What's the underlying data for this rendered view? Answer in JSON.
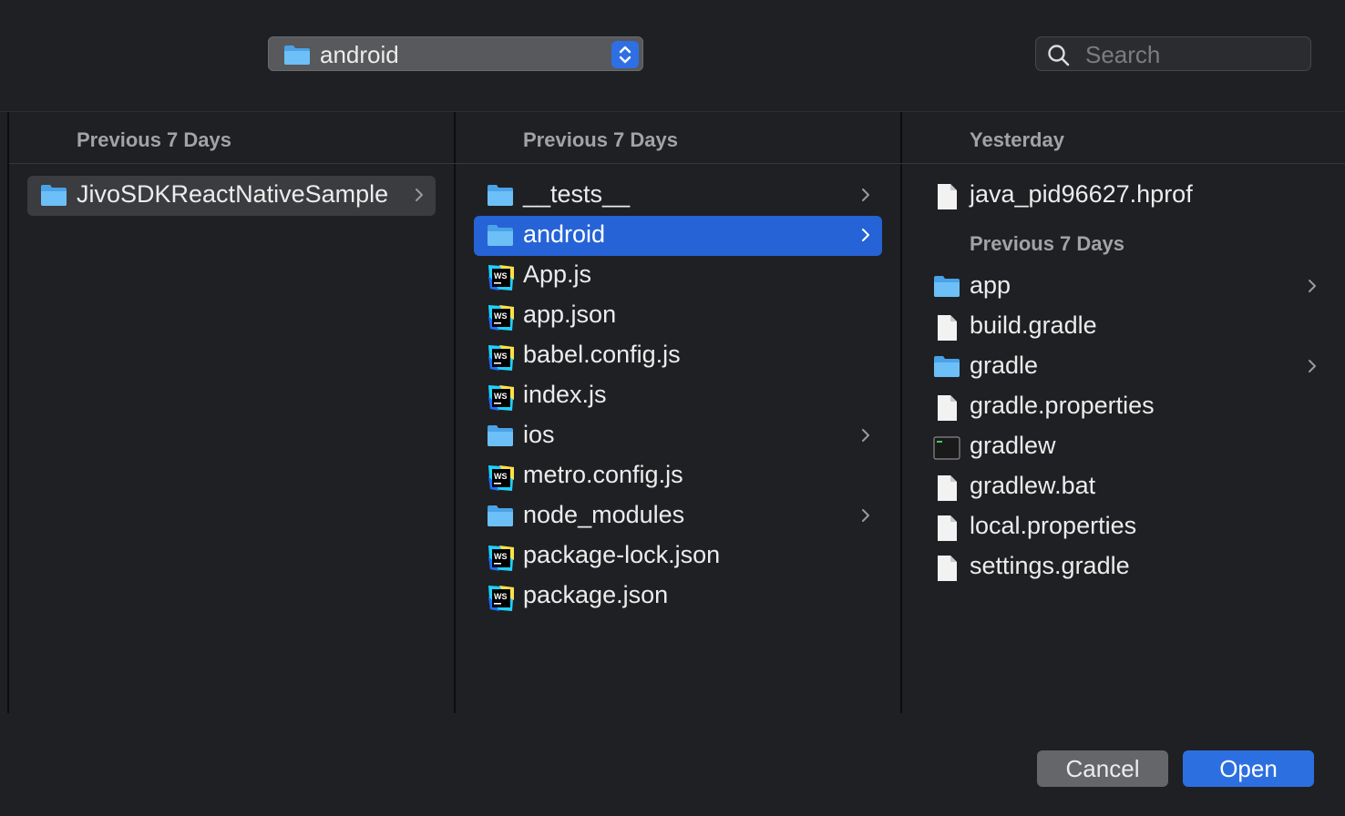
{
  "toolbar": {
    "path_label": "android",
    "search_placeholder": "Search"
  },
  "columns": [
    {
      "header": "Previous 7 Days",
      "items": [
        {
          "name": "JivoSDKReactNativeSample",
          "kind": "folder",
          "has_children": true,
          "selected": "inactive"
        }
      ]
    },
    {
      "header": "Previous 7 Days",
      "items": [
        {
          "name": "__tests__",
          "kind": "folder",
          "has_children": true
        },
        {
          "name": "android",
          "kind": "folder",
          "has_children": true,
          "selected": "active"
        },
        {
          "name": "App.js",
          "kind": "webstorm"
        },
        {
          "name": "app.json",
          "kind": "webstorm"
        },
        {
          "name": "babel.config.js",
          "kind": "webstorm"
        },
        {
          "name": "index.js",
          "kind": "webstorm"
        },
        {
          "name": "ios",
          "kind": "folder",
          "has_children": true
        },
        {
          "name": "metro.config.js",
          "kind": "webstorm"
        },
        {
          "name": "node_modules",
          "kind": "folder",
          "has_children": true
        },
        {
          "name": "package-lock.json",
          "kind": "webstorm"
        },
        {
          "name": "package.json",
          "kind": "webstorm"
        }
      ]
    },
    {
      "header": "Yesterday",
      "items": [
        {
          "name": "java_pid96627.hprof",
          "kind": "document"
        }
      ],
      "sub_header": "Previous 7 Days",
      "sub_items": [
        {
          "name": "app",
          "kind": "folder",
          "has_children": true
        },
        {
          "name": "build.gradle",
          "kind": "document"
        },
        {
          "name": "gradle",
          "kind": "folder",
          "has_children": true
        },
        {
          "name": "gradle.properties",
          "kind": "document"
        },
        {
          "name": "gradlew",
          "kind": "terminal"
        },
        {
          "name": "gradlew.bat",
          "kind": "document"
        },
        {
          "name": "local.properties",
          "kind": "document"
        },
        {
          "name": "settings.gradle",
          "kind": "document"
        }
      ]
    }
  ],
  "buttons": {
    "cancel": "Cancel",
    "open": "Open"
  },
  "colors": {
    "accent": "#2563d6",
    "background": "#1f2023",
    "folder": "#5fb3f0"
  }
}
